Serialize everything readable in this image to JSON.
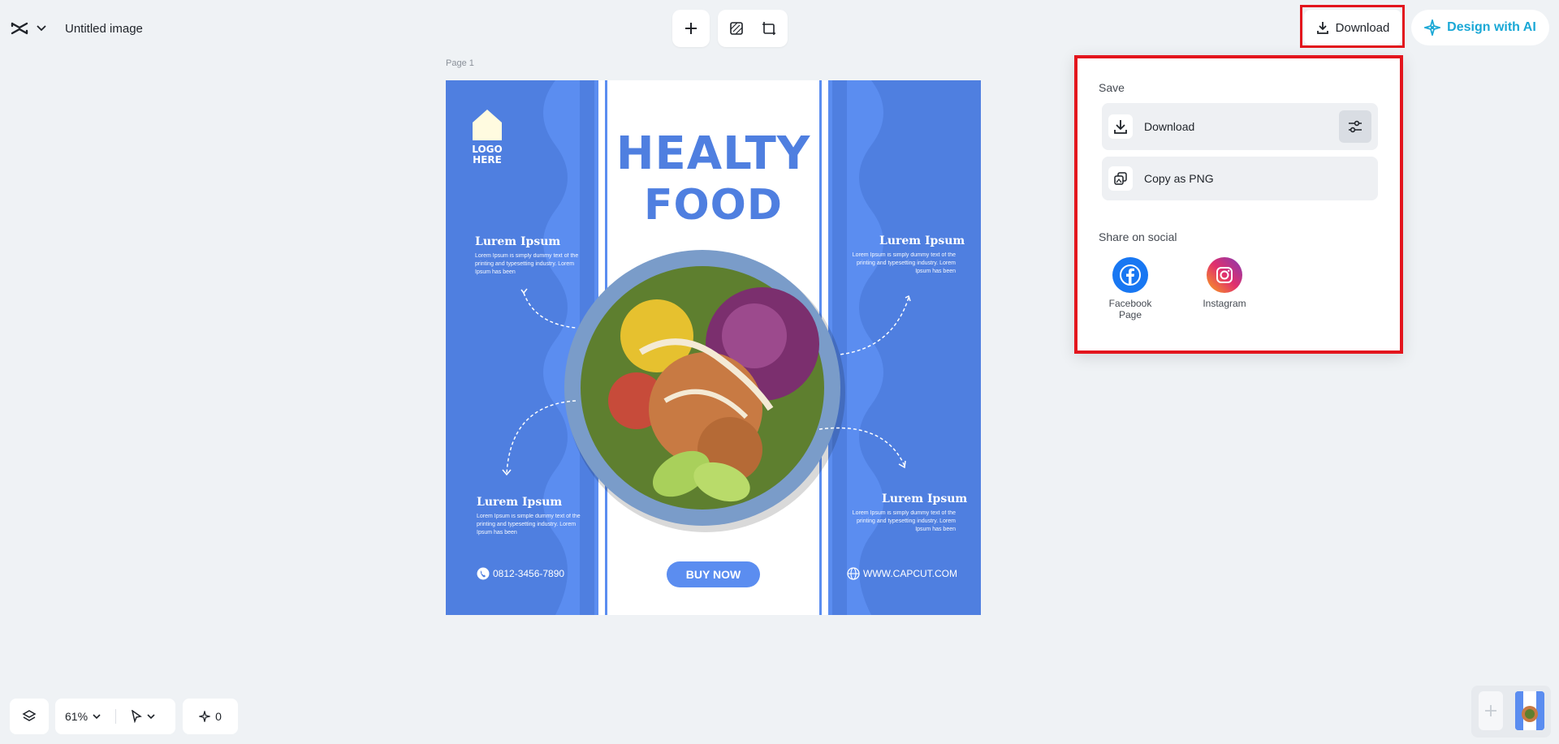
{
  "header": {
    "title": "Untitled image",
    "download_label": "Download",
    "ai_label": "Design with AI"
  },
  "canvas": {
    "page_label": "Page 1"
  },
  "design": {
    "logo_text_1": "LOGO",
    "logo_text_2": "HERE",
    "headline_1": "HEALTY",
    "headline_2": "FOOD",
    "blocks": [
      {
        "title": "Lurem Ipsum",
        "body": "Lorem Ipsum is simply dummy text of the printing and typesetting industry. Lorem Ipsum has been"
      },
      {
        "title": "Lurem Ipsum",
        "body": "Lorem Ipsum is simply dummy text of the printing and typesetting industry. Lorem Ipsum has been"
      },
      {
        "title": "Lurem Ipsum",
        "body": "Lorem Ipsum is simple dummy text of the printing and typesetting industry. Lorem Ipsum has been"
      },
      {
        "title": "Lurem Ipsum",
        "body": "Lorem Ipsum is simply dummy text of the printing and typesetting industry. Lorem Ipsum has been"
      }
    ],
    "phone": "0812-3456-7890",
    "website": "WWW.CAPCUT.COM",
    "buy_label": "BUY NOW"
  },
  "menu": {
    "save_heading": "Save",
    "download_label": "Download",
    "copy_label": "Copy as PNG",
    "share_heading": "Share on social",
    "facebook_label_1": "Facebook",
    "facebook_label_2": "Page",
    "instagram_label": "Instagram"
  },
  "bottom": {
    "zoom": "61%",
    "counter": "0"
  },
  "colors": {
    "accent_red": "#e3151d",
    "design_blue": "#5b8df0",
    "ai_cyan": "#1aa8d6",
    "facebook_blue": "#1877f2"
  }
}
